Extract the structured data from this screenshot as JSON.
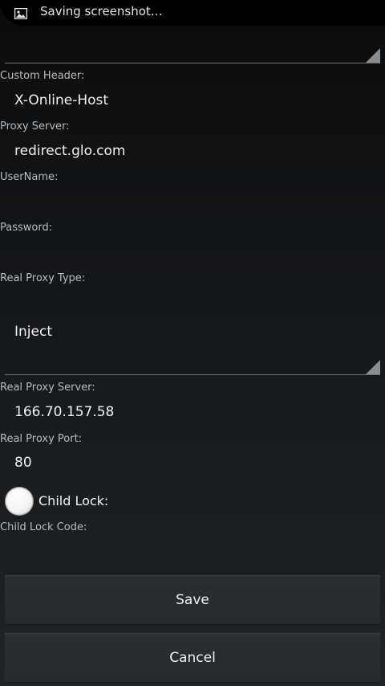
{
  "status_bar": {
    "notification_text": "Saving screenshot…",
    "icon": "image-icon"
  },
  "form": {
    "custom_header": {
      "label": "Custom Header:",
      "value": "X-Online-Host"
    },
    "proxy_server": {
      "label": "Proxy Server:",
      "value": "redirect.glo.com"
    },
    "username": {
      "label": "UserName:",
      "value": ""
    },
    "password": {
      "label": "Password:",
      "value": ""
    },
    "real_proxy_type": {
      "label": "Real Proxy Type:",
      "value": "Inject"
    },
    "real_proxy_server": {
      "label": "Real Proxy Server:",
      "value": "166.70.157.58"
    },
    "real_proxy_port": {
      "label": "Real Proxy Port:",
      "value": "80"
    },
    "child_lock": {
      "label": "Child Lock:",
      "checked": false
    },
    "child_lock_code": {
      "label": "Child Lock Code:",
      "value": ""
    }
  },
  "buttons": {
    "save": "Save",
    "cancel": "Cancel"
  }
}
